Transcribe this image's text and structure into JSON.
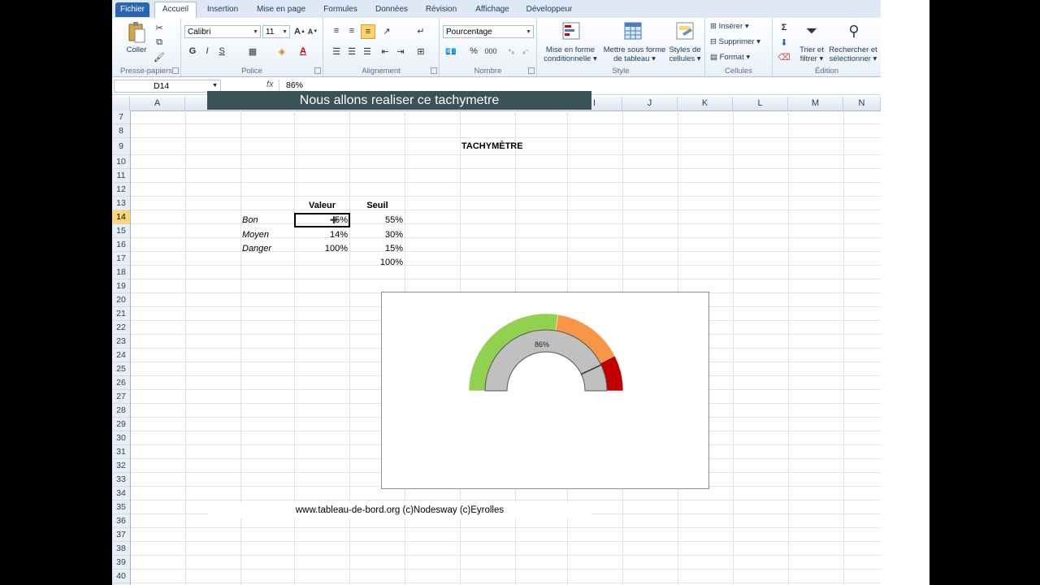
{
  "tabs": [
    "Fichier",
    "Accueil",
    "Insertion",
    "Mise en page",
    "Formules",
    "Données",
    "Révision",
    "Affichage",
    "Développeur"
  ],
  "ribbon": {
    "clipboard": {
      "paste_label": "Coller",
      "group_label": "Presse-papiers"
    },
    "font": {
      "name": "Calibri",
      "size": "11",
      "bold": "G",
      "italic": "I",
      "underline": "S",
      "group_label": "Police"
    },
    "alignment": {
      "group_label": "Alignement"
    },
    "number": {
      "format": "Pourcentage",
      "percent": "%",
      "thousands": "000",
      "group_label": "Nombre"
    },
    "style": {
      "conditional_line1": "Mise en forme",
      "conditional_line2": "conditionnelle",
      "table_line1": "Mettre sous forme",
      "table_line2": "de tableau",
      "cell_styles_line1": "Styles de",
      "cell_styles_line2": "cellules",
      "group_label": "Style"
    },
    "cells": {
      "insert": "Insérer",
      "delete": "Supprimer",
      "format": "Format",
      "group_label": "Cellules"
    },
    "editing": {
      "sort_line1": "Trier et",
      "sort_line2": "filtrer",
      "find_line1": "Rechercher et",
      "find_line2": "sélectionner",
      "group_label": "Édition"
    }
  },
  "formula_bar": {
    "name_box": "D14",
    "fx": "fx",
    "content": "86%"
  },
  "columns": [
    "A",
    "I",
    "J",
    "K",
    "L",
    "M",
    "N"
  ],
  "rows": [
    "7",
    "8",
    "9",
    "10",
    "11",
    "12",
    "13",
    "14",
    "15",
    "16",
    "17",
    "18",
    "19",
    "20",
    "21",
    "22",
    "23",
    "24",
    "25",
    "26",
    "27",
    "28",
    "29",
    "30",
    "31",
    "32",
    "33",
    "34",
    "35",
    "36",
    "37",
    "38",
    "39",
    "40"
  ],
  "banner": "Nous allons realiser ce tachymetre",
  "sheet": {
    "title": "TACHYMÈTRE",
    "header_valeur": "Valeur",
    "header_seuil": "Seuil",
    "rows": [
      {
        "label": "Bon",
        "valeur": "5%",
        "seuil": "55%"
      },
      {
        "label": "Moyen",
        "valeur": "14%",
        "seuil": "30%"
      },
      {
        "label": "Danger",
        "valeur": "100%",
        "seuil": "15%"
      },
      {
        "label": "",
        "valeur": "",
        "seuil": "100%"
      }
    ]
  },
  "chart_data": {
    "type": "pie",
    "value_label": "86%",
    "outer_ring": [
      {
        "name": "Bon",
        "value": 55,
        "color": "#92d050"
      },
      {
        "name": "Moyen",
        "value": 30,
        "color": "#f79646"
      },
      {
        "name": "Danger",
        "value": 15,
        "color": "#c00000"
      }
    ],
    "inner_ring": {
      "value": 86,
      "color": "#c0c0c0"
    }
  },
  "footer": "www.tableau-de-bord.org (c)Nodesway (c)Eyrolles"
}
